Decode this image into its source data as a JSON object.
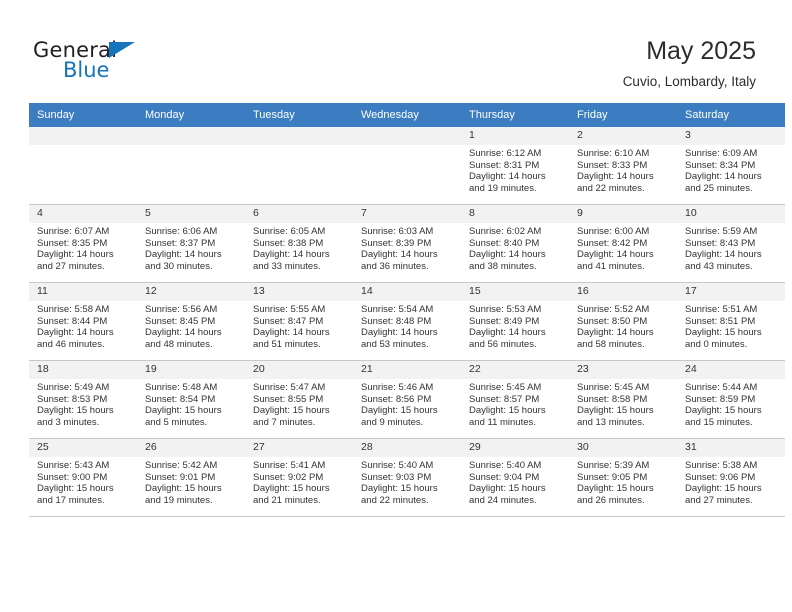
{
  "brand": {
    "name_primary": "General",
    "name_secondary": "Blue",
    "logo_icon": "triangle-flag-icon",
    "primary_color": "#1574bb",
    "text_color": "#231f20"
  },
  "header": {
    "title": "May 2025",
    "subtitle": "Cuvio, Lombardy, Italy"
  },
  "calendar": {
    "header_bg": "#3b7dc0",
    "daynum_bg": "#f2f2f2",
    "weekday_headers": [
      "Sunday",
      "Monday",
      "Tuesday",
      "Wednesday",
      "Thursday",
      "Friday",
      "Saturday"
    ],
    "weeks": [
      [
        {
          "day": "",
          "sunrise": "",
          "sunset": "",
          "daylight_line1": "",
          "daylight_line2": ""
        },
        {
          "day": "",
          "sunrise": "",
          "sunset": "",
          "daylight_line1": "",
          "daylight_line2": ""
        },
        {
          "day": "",
          "sunrise": "",
          "sunset": "",
          "daylight_line1": "",
          "daylight_line2": ""
        },
        {
          "day": "",
          "sunrise": "",
          "sunset": "",
          "daylight_line1": "",
          "daylight_line2": ""
        },
        {
          "day": "1",
          "sunrise": "Sunrise: 6:12 AM",
          "sunset": "Sunset: 8:31 PM",
          "daylight_line1": "Daylight: 14 hours",
          "daylight_line2": "and 19 minutes."
        },
        {
          "day": "2",
          "sunrise": "Sunrise: 6:10 AM",
          "sunset": "Sunset: 8:33 PM",
          "daylight_line1": "Daylight: 14 hours",
          "daylight_line2": "and 22 minutes."
        },
        {
          "day": "3",
          "sunrise": "Sunrise: 6:09 AM",
          "sunset": "Sunset: 8:34 PM",
          "daylight_line1": "Daylight: 14 hours",
          "daylight_line2": "and 25 minutes."
        }
      ],
      [
        {
          "day": "4",
          "sunrise": "Sunrise: 6:07 AM",
          "sunset": "Sunset: 8:35 PM",
          "daylight_line1": "Daylight: 14 hours",
          "daylight_line2": "and 27 minutes."
        },
        {
          "day": "5",
          "sunrise": "Sunrise: 6:06 AM",
          "sunset": "Sunset: 8:37 PM",
          "daylight_line1": "Daylight: 14 hours",
          "daylight_line2": "and 30 minutes."
        },
        {
          "day": "6",
          "sunrise": "Sunrise: 6:05 AM",
          "sunset": "Sunset: 8:38 PM",
          "daylight_line1": "Daylight: 14 hours",
          "daylight_line2": "and 33 minutes."
        },
        {
          "day": "7",
          "sunrise": "Sunrise: 6:03 AM",
          "sunset": "Sunset: 8:39 PM",
          "daylight_line1": "Daylight: 14 hours",
          "daylight_line2": "and 36 minutes."
        },
        {
          "day": "8",
          "sunrise": "Sunrise: 6:02 AM",
          "sunset": "Sunset: 8:40 PM",
          "daylight_line1": "Daylight: 14 hours",
          "daylight_line2": "and 38 minutes."
        },
        {
          "day": "9",
          "sunrise": "Sunrise: 6:00 AM",
          "sunset": "Sunset: 8:42 PM",
          "daylight_line1": "Daylight: 14 hours",
          "daylight_line2": "and 41 minutes."
        },
        {
          "day": "10",
          "sunrise": "Sunrise: 5:59 AM",
          "sunset": "Sunset: 8:43 PM",
          "daylight_line1": "Daylight: 14 hours",
          "daylight_line2": "and 43 minutes."
        }
      ],
      [
        {
          "day": "11",
          "sunrise": "Sunrise: 5:58 AM",
          "sunset": "Sunset: 8:44 PM",
          "daylight_line1": "Daylight: 14 hours",
          "daylight_line2": "and 46 minutes."
        },
        {
          "day": "12",
          "sunrise": "Sunrise: 5:56 AM",
          "sunset": "Sunset: 8:45 PM",
          "daylight_line1": "Daylight: 14 hours",
          "daylight_line2": "and 48 minutes."
        },
        {
          "day": "13",
          "sunrise": "Sunrise: 5:55 AM",
          "sunset": "Sunset: 8:47 PM",
          "daylight_line1": "Daylight: 14 hours",
          "daylight_line2": "and 51 minutes."
        },
        {
          "day": "14",
          "sunrise": "Sunrise: 5:54 AM",
          "sunset": "Sunset: 8:48 PM",
          "daylight_line1": "Daylight: 14 hours",
          "daylight_line2": "and 53 minutes."
        },
        {
          "day": "15",
          "sunrise": "Sunrise: 5:53 AM",
          "sunset": "Sunset: 8:49 PM",
          "daylight_line1": "Daylight: 14 hours",
          "daylight_line2": "and 56 minutes."
        },
        {
          "day": "16",
          "sunrise": "Sunrise: 5:52 AM",
          "sunset": "Sunset: 8:50 PM",
          "daylight_line1": "Daylight: 14 hours",
          "daylight_line2": "and 58 minutes."
        },
        {
          "day": "17",
          "sunrise": "Sunrise: 5:51 AM",
          "sunset": "Sunset: 8:51 PM",
          "daylight_line1": "Daylight: 15 hours",
          "daylight_line2": "and 0 minutes."
        }
      ],
      [
        {
          "day": "18",
          "sunrise": "Sunrise: 5:49 AM",
          "sunset": "Sunset: 8:53 PM",
          "daylight_line1": "Daylight: 15 hours",
          "daylight_line2": "and 3 minutes."
        },
        {
          "day": "19",
          "sunrise": "Sunrise: 5:48 AM",
          "sunset": "Sunset: 8:54 PM",
          "daylight_line1": "Daylight: 15 hours",
          "daylight_line2": "and 5 minutes."
        },
        {
          "day": "20",
          "sunrise": "Sunrise: 5:47 AM",
          "sunset": "Sunset: 8:55 PM",
          "daylight_line1": "Daylight: 15 hours",
          "daylight_line2": "and 7 minutes."
        },
        {
          "day": "21",
          "sunrise": "Sunrise: 5:46 AM",
          "sunset": "Sunset: 8:56 PM",
          "daylight_line1": "Daylight: 15 hours",
          "daylight_line2": "and 9 minutes."
        },
        {
          "day": "22",
          "sunrise": "Sunrise: 5:45 AM",
          "sunset": "Sunset: 8:57 PM",
          "daylight_line1": "Daylight: 15 hours",
          "daylight_line2": "and 11 minutes."
        },
        {
          "day": "23",
          "sunrise": "Sunrise: 5:45 AM",
          "sunset": "Sunset: 8:58 PM",
          "daylight_line1": "Daylight: 15 hours",
          "daylight_line2": "and 13 minutes."
        },
        {
          "day": "24",
          "sunrise": "Sunrise: 5:44 AM",
          "sunset": "Sunset: 8:59 PM",
          "daylight_line1": "Daylight: 15 hours",
          "daylight_line2": "and 15 minutes."
        }
      ],
      [
        {
          "day": "25",
          "sunrise": "Sunrise: 5:43 AM",
          "sunset": "Sunset: 9:00 PM",
          "daylight_line1": "Daylight: 15 hours",
          "daylight_line2": "and 17 minutes."
        },
        {
          "day": "26",
          "sunrise": "Sunrise: 5:42 AM",
          "sunset": "Sunset: 9:01 PM",
          "daylight_line1": "Daylight: 15 hours",
          "daylight_line2": "and 19 minutes."
        },
        {
          "day": "27",
          "sunrise": "Sunrise: 5:41 AM",
          "sunset": "Sunset: 9:02 PM",
          "daylight_line1": "Daylight: 15 hours",
          "daylight_line2": "and 21 minutes."
        },
        {
          "day": "28",
          "sunrise": "Sunrise: 5:40 AM",
          "sunset": "Sunset: 9:03 PM",
          "daylight_line1": "Daylight: 15 hours",
          "daylight_line2": "and 22 minutes."
        },
        {
          "day": "29",
          "sunrise": "Sunrise: 5:40 AM",
          "sunset": "Sunset: 9:04 PM",
          "daylight_line1": "Daylight: 15 hours",
          "daylight_line2": "and 24 minutes."
        },
        {
          "day": "30",
          "sunrise": "Sunrise: 5:39 AM",
          "sunset": "Sunset: 9:05 PM",
          "daylight_line1": "Daylight: 15 hours",
          "daylight_line2": "and 26 minutes."
        },
        {
          "day": "31",
          "sunrise": "Sunrise: 5:38 AM",
          "sunset": "Sunset: 9:06 PM",
          "daylight_line1": "Daylight: 15 hours",
          "daylight_line2": "and 27 minutes."
        }
      ]
    ]
  }
}
